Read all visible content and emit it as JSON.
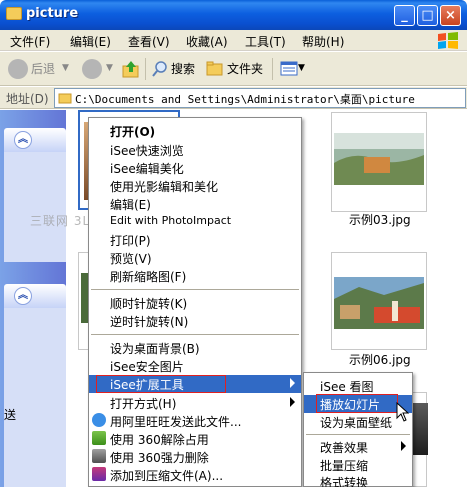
{
  "window": {
    "title": "picture"
  },
  "menubar": [
    {
      "label": "文件(F)"
    },
    {
      "label": "编辑(E)"
    },
    {
      "label": "查看(V)"
    },
    {
      "label": "收藏(A)"
    },
    {
      "label": "工具(T)"
    },
    {
      "label": "帮助(H)"
    }
  ],
  "toolbar": {
    "back": "后退",
    "search": "搜索",
    "folders": "文件夹"
  },
  "address": {
    "label": "地址(D)",
    "path": "C:\\Documents and Settings\\Administrator\\桌面\\picture"
  },
  "sidebar": {
    "vertical_text": "送"
  },
  "thumbnails": [
    {
      "label": "示例03.jpg"
    },
    {
      "label": "示例06.jpg"
    }
  ],
  "watermark": "三联网 3LIAN.COM",
  "context_menu": {
    "items": [
      {
        "label": "打开(O)",
        "bold": true
      },
      {
        "label": "iSee快速浏览"
      },
      {
        "label": "iSee编辑美化"
      },
      {
        "label": "使用光影编辑和美化"
      },
      {
        "label": "编辑(E)"
      },
      {
        "label": "Edit with PhotoImpact"
      },
      {
        "label": "打印(P)"
      },
      {
        "label": "预览(V)"
      },
      {
        "label": "刷新缩略图(F)"
      },
      {
        "label": "顺时针旋转(K)"
      },
      {
        "label": "逆时针旋转(N)"
      },
      {
        "label": "设为桌面背景(B)"
      },
      {
        "label": "iSee安全图片"
      },
      {
        "label": "iSee扩展工具"
      },
      {
        "label": "打开方式(H)"
      },
      {
        "label": "用阿里旺旺发送此文件..."
      },
      {
        "label": "使用 360解除占用"
      },
      {
        "label": "使用 360强力删除"
      },
      {
        "label": "添加到压缩文件(A)..."
      }
    ]
  },
  "submenu": {
    "items": [
      {
        "label": "iSee 看图"
      },
      {
        "label": "播放幻灯片"
      },
      {
        "label": "设为桌面壁纸"
      },
      {
        "label": "改善效果"
      },
      {
        "label": "批量压缩"
      },
      {
        "label": "格式转换"
      }
    ]
  },
  "colors": {
    "title_blue": "#0a5fd8",
    "highlight": "#316ac5",
    "annotation_red": "#e02020"
  }
}
